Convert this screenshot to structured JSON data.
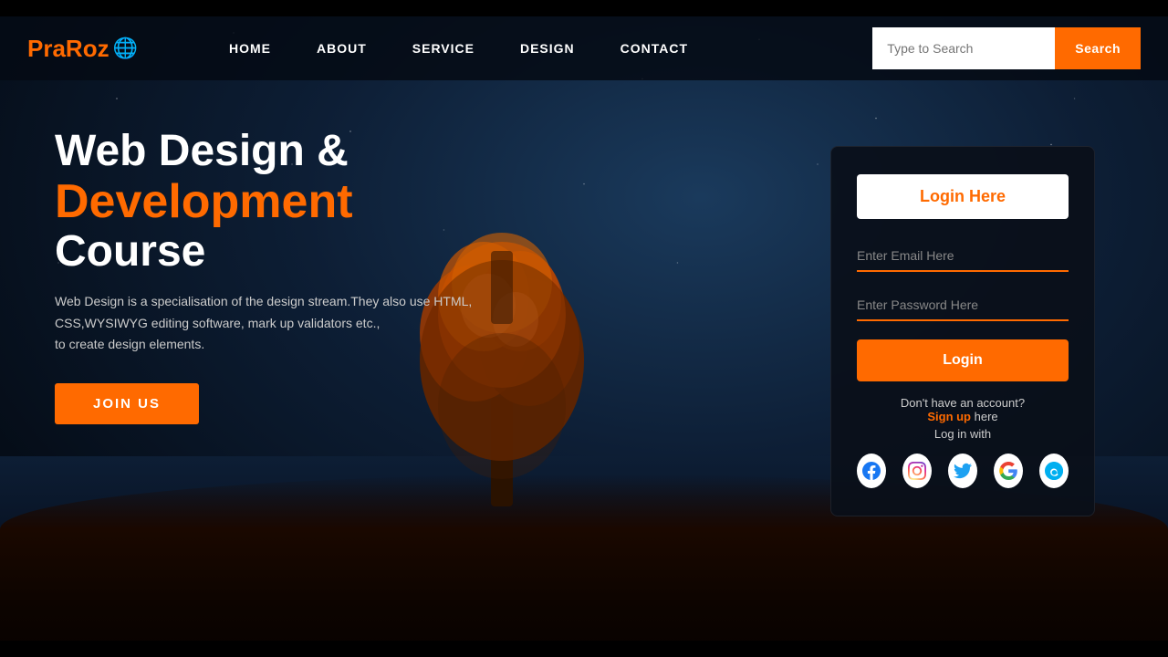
{
  "brand": {
    "name": "PraRoz",
    "globe": "🌐"
  },
  "navbar": {
    "links": [
      {
        "label": "HOME",
        "id": "home"
      },
      {
        "label": "ABOUT",
        "id": "about"
      },
      {
        "label": "SERVICE",
        "id": "service"
      },
      {
        "label": "DESIGN",
        "id": "design"
      },
      {
        "label": "CONTACT",
        "id": "contact"
      }
    ],
    "search_placeholder": "Type to Search",
    "search_button": "Search"
  },
  "hero": {
    "title_line1": "Web Design &",
    "title_line2": "Development",
    "title_line3": "Course",
    "description": "Web Design is a specialisation of the design stream.They also use HTML,\nCSS,WYSIWYG editing software, mark up validators etc.,\nto create design elements.",
    "cta_button": "JOIN US"
  },
  "login_card": {
    "title": "Login Here",
    "email_placeholder": "Enter Email Here",
    "password_placeholder": "Enter Password Here",
    "login_button": "Login",
    "no_account_text": "Don't have an account?",
    "signup_text": "Sign up",
    "signup_suffix": " here",
    "log_in_with": "Log in with",
    "social": [
      {
        "name": "Facebook",
        "icon": "f"
      },
      {
        "name": "Instagram",
        "icon": "📷"
      },
      {
        "name": "Twitter",
        "icon": "🐦"
      },
      {
        "name": "Google",
        "icon": "G"
      },
      {
        "name": "Skype",
        "icon": "S"
      }
    ]
  },
  "colors": {
    "orange": "#ff6a00",
    "white": "#ffffff",
    "dark_bg": "#0a0f19"
  }
}
